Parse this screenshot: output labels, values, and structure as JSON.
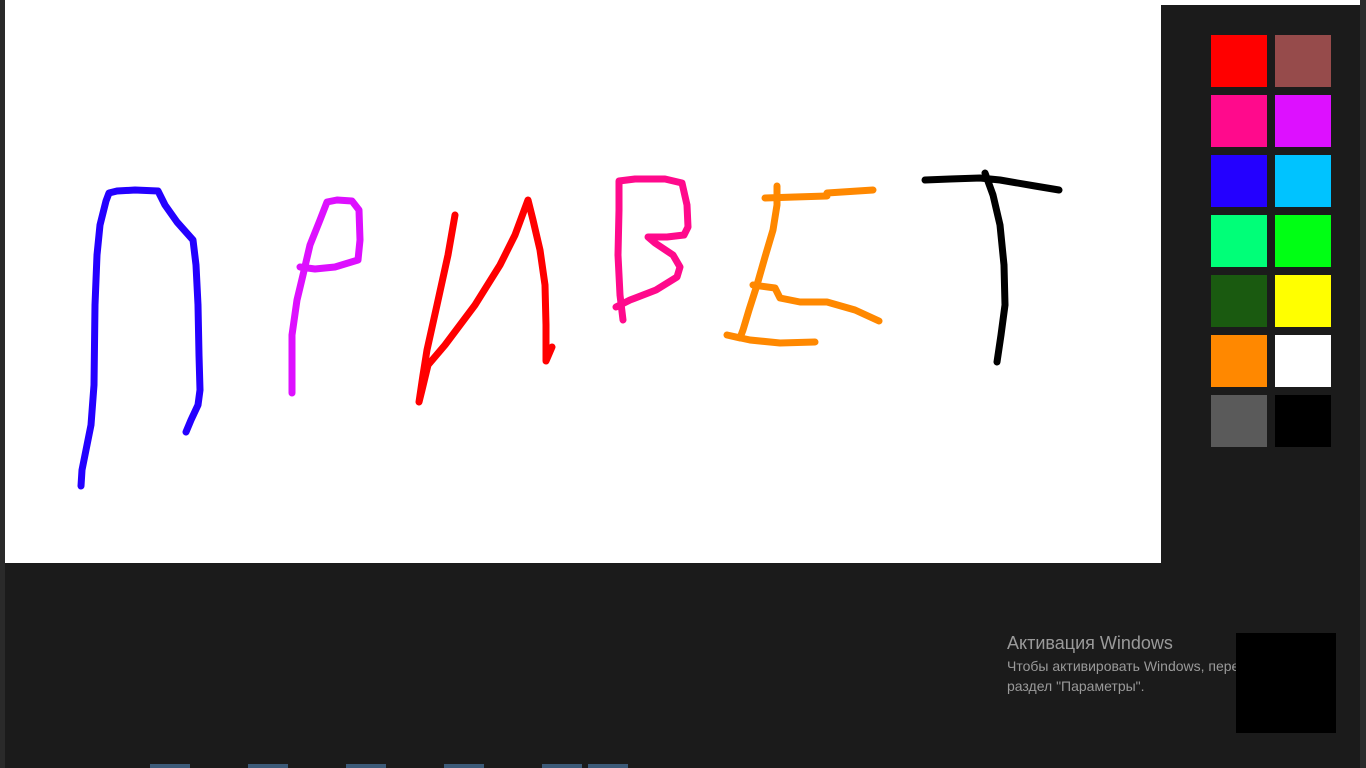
{
  "canvas": {
    "background": "#ffffff",
    "strokes": [
      {
        "color": "#2400ff",
        "letter": "П"
      },
      {
        "color": "#dd10ff",
        "letter": "Р"
      },
      {
        "color": "#ff0000",
        "letter": "И"
      },
      {
        "color": "#ff0a8c",
        "letter": "В"
      },
      {
        "color": "#ff8800",
        "letter": "Е"
      },
      {
        "color": "#000000",
        "letter": "Т"
      }
    ]
  },
  "palette": {
    "colors": [
      "#ff0000",
      "#964b4b",
      "#ff0a8c",
      "#dd10ff",
      "#2400ff",
      "#00c3ff",
      "#00ff78",
      "#00ff14",
      "#1a5a10",
      "#ffff00",
      "#ff8800",
      "#ffffff",
      "#5a5a5a",
      "#000000"
    ]
  },
  "activation": {
    "title": "Активация Windows",
    "line1": "Чтобы активировать Windows, перейдите в",
    "line2": "раздел \"Параметры\"."
  }
}
